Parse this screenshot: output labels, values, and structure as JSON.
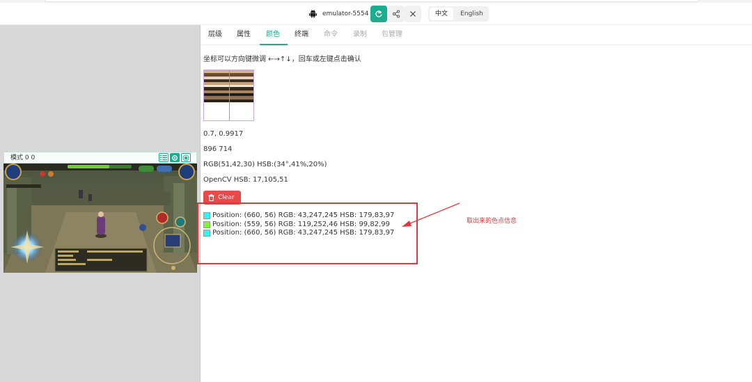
{
  "toolbar": {
    "device_name": "emulator-5554",
    "icons": [
      "android-icon",
      "refresh-icon",
      "share-icon",
      "close-icon"
    ],
    "lang_zh": "中文",
    "lang_en": "English",
    "accent_color": "#1aad8e"
  },
  "device": {
    "mode_label": "模式 0 0",
    "mode_icons": [
      "list-icon",
      "settings-icon",
      "record-icon"
    ]
  },
  "tabs": [
    {
      "label": "层级",
      "state": "normal"
    },
    {
      "label": "属性",
      "state": "normal"
    },
    {
      "label": "颜色",
      "state": "active"
    },
    {
      "label": "终端",
      "state": "normal"
    },
    {
      "label": "命令",
      "state": "disabled"
    },
    {
      "label": "录制",
      "state": "disabled"
    },
    {
      "label": "包管理",
      "state": "disabled"
    }
  ],
  "color_panel": {
    "hint": "坐标可以方向键微调 ←→↑↓，回车或左键点击确认",
    "ratio": "0.7, 0.9917",
    "coords": "896 714",
    "rgb_hsb": "RGB(51,42,30) HSB:(34°,41%,20%)",
    "opencv_hsb": "OpenCV HSB: 17,105,51",
    "clear_label": "Clear",
    "clear_color": "#e84a4a",
    "picked": [
      {
        "text": "Position: (660, 56) RGB: 43,247,245 HSB: 179,83,97",
        "color": "#2bf7f5"
      },
      {
        "text": "Position: (559, 56) RGB: 119,252,46 HSB: 99,82,99",
        "color": "#77fc2e"
      },
      {
        "text": "Position: (660, 56) RGB: 43,247,245 HSB: 179,83,97",
        "color": "#2bf7f5"
      }
    ]
  },
  "annotation": {
    "text": "取出来的色点信息",
    "color": "#e2363a"
  }
}
